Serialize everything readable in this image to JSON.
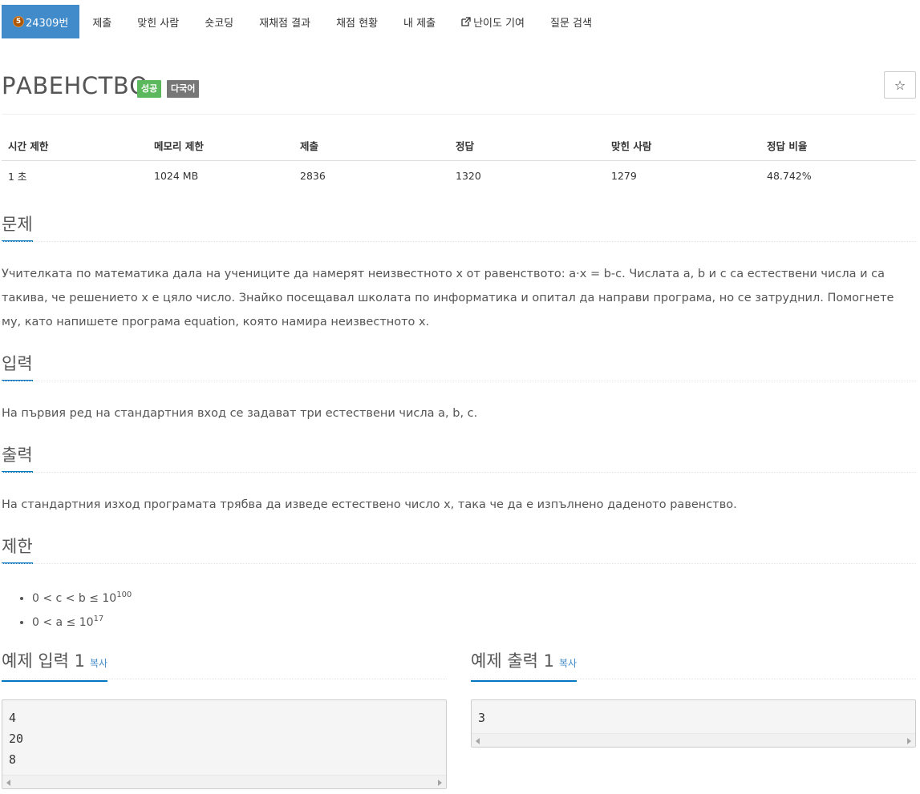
{
  "nav": {
    "problem": {
      "tier": "5",
      "number": "24309번"
    },
    "items": [
      "제출",
      "맞힌 사람",
      "숏코딩",
      "재채점 결과",
      "채점 현황",
      "내 제출",
      "난이도 기여",
      "질문 검색"
    ]
  },
  "title": "РАВЕНСТВО",
  "labels": {
    "success": "성공",
    "lang": "다국어"
  },
  "star_icon": "☆",
  "info": {
    "headers": [
      "시간 제한",
      "메모리 제한",
      "제출",
      "정답",
      "맞힌 사람",
      "정답 비율"
    ],
    "values": [
      "1 초",
      "1024 MB",
      "2836",
      "1320",
      "1279",
      "48.742%"
    ]
  },
  "sections": {
    "problem": {
      "heading": "문제",
      "text": "Учителката по математика дала на учениците да намерят неизвестното x от равенството: a·x = b-c. Числата a, b и c са естествени числа и са такива, че решението x е цяло число. Знайко посещавал школата по информатика и опитал да направи програма, но се затруднил. Помогнете му, като напишете програма equation, която намира неизвестното x."
    },
    "input": {
      "heading": "입력",
      "text": "На първия ред на стандартния вход се задават три естествени числа a, b, c."
    },
    "output": {
      "heading": "출력",
      "text": "На стандартния изход програмата трябва да изведе естествено число x, така че да е изпълнено даденото равенство."
    },
    "limits": {
      "heading": "제한",
      "items": [
        {
          "base": "0 < c < b ≤ 10",
          "exp": "100"
        },
        {
          "base": "0 < a ≤ 10",
          "exp": "17"
        }
      ]
    }
  },
  "samples": {
    "copy_label": "복사",
    "input": {
      "heading": "예제 입력 1",
      "content": "4\n20\n8"
    },
    "output": {
      "heading": "예제 출력 1",
      "content": "3"
    }
  }
}
